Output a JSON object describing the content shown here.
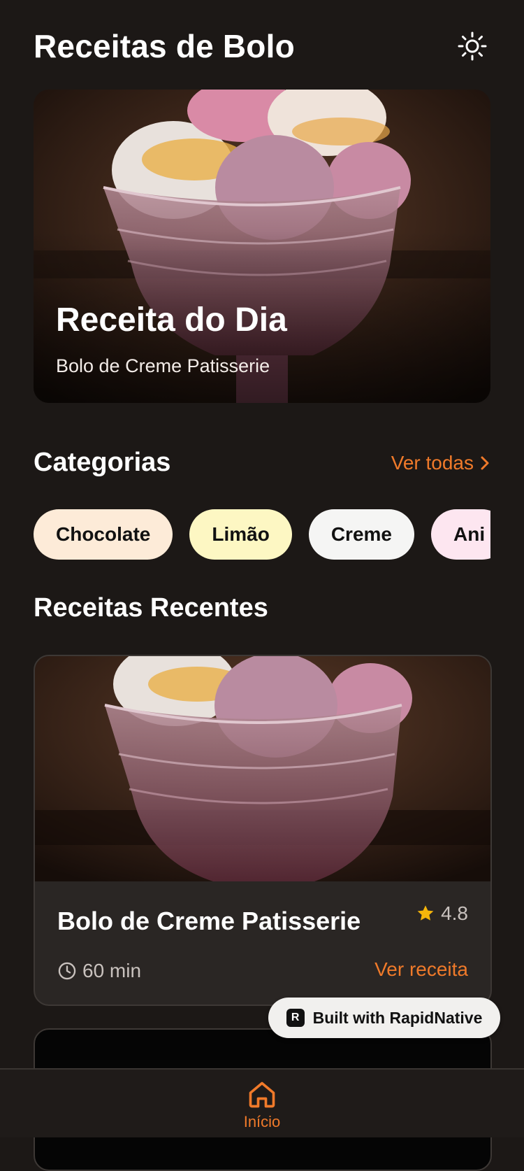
{
  "header": {
    "title": "Receitas de Bolo",
    "theme_icon": "sun-icon"
  },
  "hero": {
    "title": "Receita do Dia",
    "subtitle": "Bolo de Creme Patisserie",
    "image": "macarons-in-glass-bowl"
  },
  "categories": {
    "title": "Categorias",
    "see_all": "Ver todas",
    "items": [
      {
        "label": "Chocolate",
        "color": "#fdebd8"
      },
      {
        "label": "Limão",
        "color": "#fdf7c3"
      },
      {
        "label": "Creme",
        "color": "#f5f5f4"
      },
      {
        "label": "Ani",
        "color": "#fde6f0"
      }
    ]
  },
  "recent": {
    "title": "Receitas Recentes",
    "cards": [
      {
        "title": "Bolo de Creme Patisserie",
        "rating": "4.8",
        "time": "60 min",
        "action": "Ver receita",
        "image": "macarons-in-glass-bowl"
      }
    ]
  },
  "badge": {
    "label": "Built with RapidNative"
  },
  "tabbar": {
    "items": [
      {
        "label": "Início",
        "icon": "home-icon",
        "active": true
      }
    ]
  },
  "colors": {
    "accent": "#f07a2a",
    "background": "#1c1816",
    "card": "#2a2624",
    "star": "#f5b50a"
  }
}
